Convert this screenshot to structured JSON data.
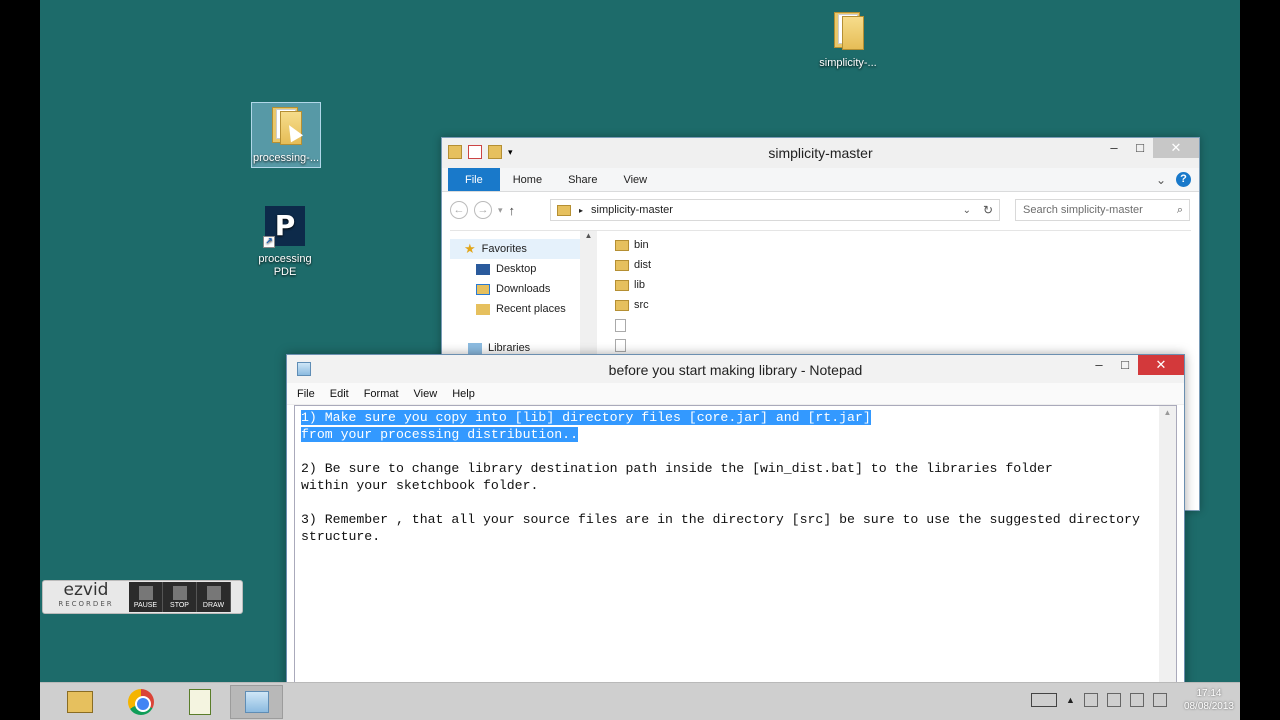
{
  "desktop": {
    "icons": [
      {
        "label": "simplicity-..."
      },
      {
        "label": "processing-..."
      },
      {
        "label": "processing PDE",
        "logo_letter": "P"
      }
    ]
  },
  "explorer": {
    "title": "simplicity-master",
    "tabs": [
      "File",
      "Home",
      "Share",
      "View"
    ],
    "address": "simplicity-master",
    "search_placeholder": "Search simplicity-master",
    "nav": {
      "favorites": "Favorites",
      "items": [
        "Desktop",
        "Downloads",
        "Recent places"
      ],
      "libraries": "Libraries"
    },
    "files": [
      "bin",
      "dist",
      "lib",
      "src"
    ]
  },
  "notepad": {
    "title": "before you start making library - Notepad",
    "menu": [
      "File",
      "Edit",
      "Format",
      "View",
      "Help"
    ],
    "lines_selected": [
      "1) Make sure you copy into [lib] directory files [core.jar] and [rt.jar]",
      "from your processing distribution.."
    ],
    "lines_rest": [
      "",
      "2) Be sure to change library destination path inside the [win_dist.bat] to the libraries folder",
      "within your sketchbook folder.",
      "",
      "3) Remember , that all your source files are in the directory [src] be sure to use the suggested directory",
      "structure."
    ]
  },
  "ezvid": {
    "logo": "ezvid",
    "sub": "RECORDER",
    "buttons": [
      "PAUSE",
      "STOP",
      "DRAW"
    ]
  },
  "taskbar": {
    "time": "17:14",
    "date": "08/08/2013"
  },
  "colors": {
    "desktop": "#1d6b6a",
    "accent": "#1979ca",
    "selection": "#3399ff",
    "close": "#d3393b"
  }
}
